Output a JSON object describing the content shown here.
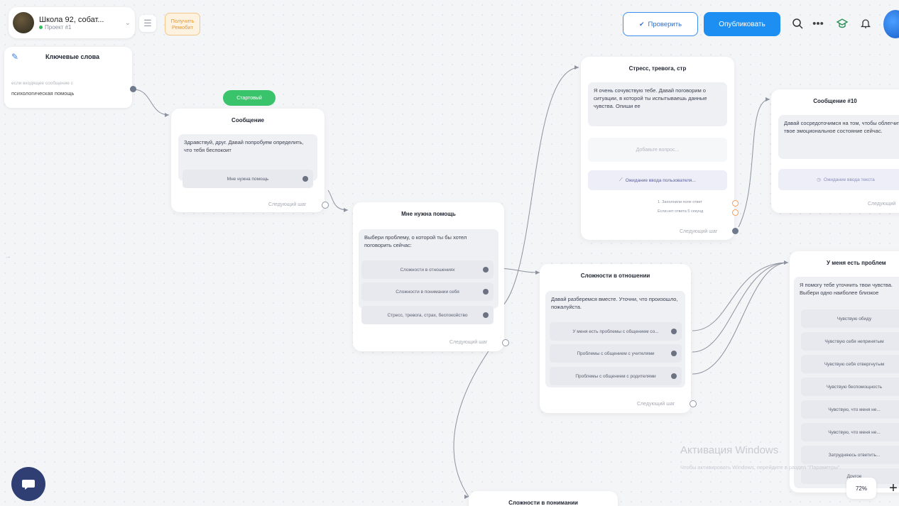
{
  "header": {
    "project_title": "Школа 92, собат...",
    "project_sub": "Проект #1",
    "bonus_label": "Получить Ремобит",
    "check_label": "Проверить",
    "publish_label": "Опубликовать"
  },
  "keywords": {
    "title": "Ключевые слова",
    "hint": "если входящее сообщение с",
    "value": "психологическая помощь"
  },
  "start_badge": "Стартовый",
  "node_message": {
    "title": "Сообщение",
    "text": "Здравствуй, друг. Давай попробуем определить, что тебя беспокоит",
    "option": "Мне нужна помощь",
    "next": "Следующий шаг"
  },
  "node_help": {
    "title": "Мне нужна помощь",
    "text": "Выбери проблему, о которой ты бы хотел поговорить сейчас:",
    "options": [
      "Сложности в отношениях",
      "Сложности в понимании себя",
      "Стресс, тревога, страх, беспокойство"
    ],
    "next": "Следующий шаг"
  },
  "node_stress": {
    "title": "Стресс, тревога, стр",
    "text": "Я очень сочувствую тебе. Давай поговорим о ситуации, в которой ты испытываешь данные чувства. Опиши ее",
    "add": "Добавьте вопрос...",
    "wait": "Ожидание ввода пользователя...",
    "t1": "1. Заполнили поле ответ",
    "t2": "Если нет ответа 5 секунд",
    "next": "Следующий шаг"
  },
  "node_msg10": {
    "title": "Сообщение #10",
    "text": "Давай сосредоточимся на том, чтобы облегчить твое эмоциональное состояние сейчас.",
    "wait": "Ожидание ввода текста",
    "next": "Следующий"
  },
  "node_rel": {
    "title": "Сложности в отношении",
    "text": "Давай разберемся вместе. Уточни, что произошло, пожалуйста.",
    "options": [
      "У меня есть проблемы с общением со...",
      "Проблемы с общением с учителями",
      "Проблемы с общением с родителями"
    ],
    "next": "Следующий шаг"
  },
  "node_problem": {
    "title": "У меня есть проблем",
    "text": "Я помогу тебе уточнить твои чувства. Выбери одно наиболее близкое",
    "options": [
      "Чувствую обиду",
      "Чувствую себя непринятым",
      "Чувствую себя отвергнутым",
      "Чувствую беспомощность",
      "Чувствую, что меня не...",
      "Чувствую, что меня не...",
      "Затрудняюсь ответить...",
      "Другое"
    ]
  },
  "node_understand": {
    "title": "Сложности в понимании"
  },
  "watermark": {
    "title": "Активация Windows",
    "text": "Чтобы активировать Windows, перейдите в раздел \"Параметры\"."
  },
  "zoom": "72%"
}
